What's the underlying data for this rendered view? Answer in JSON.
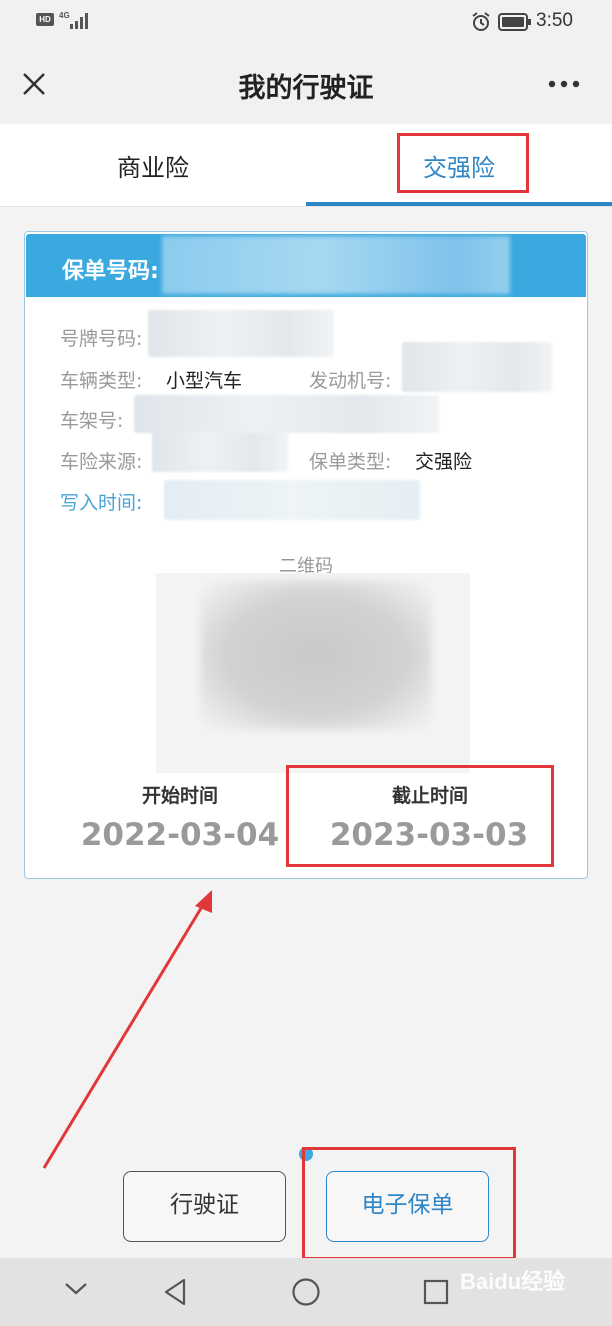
{
  "status_bar": {
    "hd": "HD",
    "network": "4G",
    "time": "3:50"
  },
  "header": {
    "title": "我的行驶证",
    "close_icon": "close-icon",
    "more_icon": "more-icon"
  },
  "tabs": [
    {
      "label": "商业险",
      "active": false
    },
    {
      "label": "交强险",
      "active": true
    }
  ],
  "card": {
    "policy_number_label": "保单号码:",
    "fields": {
      "plate_label": "号牌号码:",
      "vehicle_type_label": "车辆类型:",
      "vehicle_type_value": "小型汽车",
      "engine_label": "发动机号:",
      "frame_label": "车架号:",
      "source_label": "车险来源:",
      "policy_type_label": "保单类型:",
      "policy_type_value": "交强险",
      "write_time_label": "写入时间:"
    },
    "qr_label": "二维码",
    "start_label": "开始时间",
    "start_date": "2022-03-04",
    "end_label": "截止时间",
    "end_date": "2023-03-03"
  },
  "buttons": {
    "license": "行驶证",
    "e_policy": "电子保单"
  },
  "watermark": "Baidu经验",
  "colors": {
    "accent": "#2f86c6",
    "card_header": "#3aa9df",
    "annotation": "#e2373a"
  }
}
